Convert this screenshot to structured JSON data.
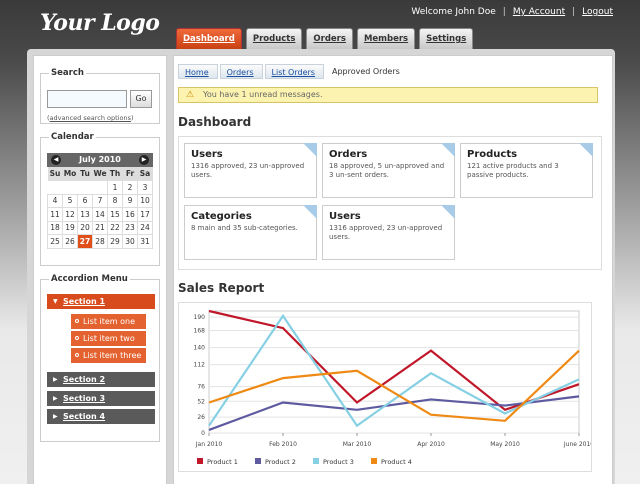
{
  "header": {
    "logo": "Your Logo",
    "welcome": "Welcome John Doe",
    "my_account": "My Account",
    "logout": "Logout",
    "separator": "|"
  },
  "tabs": [
    {
      "label": "Dashboard",
      "active": true
    },
    {
      "label": "Products"
    },
    {
      "label": "Orders"
    },
    {
      "label": "Members"
    },
    {
      "label": "Settings"
    }
  ],
  "sidebar": {
    "search": {
      "legend": "Search",
      "value": "",
      "button": "Go",
      "advanced": "advanced search options"
    },
    "calendar": {
      "legend": "Calendar",
      "month": "July 2010",
      "prev": "◀",
      "next": "▶",
      "weekdays": [
        "Su",
        "Mo",
        "Tu",
        "We",
        "Th",
        "Fr",
        "Sa"
      ],
      "weeks": [
        [
          "",
          "",
          "",
          "",
          "1",
          "2",
          "3"
        ],
        [
          "4",
          "5",
          "6",
          "7",
          "8",
          "9",
          "10"
        ],
        [
          "11",
          "12",
          "13",
          "14",
          "15",
          "16",
          "17"
        ],
        [
          "18",
          "19",
          "20",
          "21",
          "22",
          "23",
          "24"
        ],
        [
          "25",
          "26",
          "27",
          "28",
          "29",
          "30",
          "31"
        ]
      ],
      "today": "27"
    },
    "accordion": {
      "legend": "Accordion Menu",
      "sections": [
        {
          "label": "Section 1",
          "open": true,
          "items": [
            "List item one",
            "List item two",
            "List item three"
          ]
        },
        {
          "label": "Section 2"
        },
        {
          "label": "Section 3"
        },
        {
          "label": "Section 4"
        }
      ]
    }
  },
  "main": {
    "breadcrumb": [
      "Home",
      "Orders",
      "List Orders",
      "Approved Orders"
    ],
    "alert": "You have 1 unread messages.",
    "dashboard_title": "Dashboard",
    "cards": [
      {
        "title": "Users",
        "desc": "1316 approved, 23 un-approved users."
      },
      {
        "title": "Orders",
        "desc": "18 approved, 5 un-approved and 3 un-sent orders."
      },
      {
        "title": "Products",
        "desc": "121 active products and 3 passive products."
      },
      {
        "title": "Categories",
        "desc": "8 main and 35 sub-categories."
      },
      {
        "title": "Users",
        "desc": "1316 approved, 23 un-approved users."
      }
    ],
    "sales_title": "Sales Report"
  },
  "chart_data": {
    "type": "line",
    "title": "Sales Report",
    "x": [
      "Jan 2010",
      "Feb 2010",
      "Mar 2010",
      "Apr 2010",
      "May 2010",
      "June 2010"
    ],
    "yticks": [
      0,
      26,
      52,
      76,
      112,
      140,
      168,
      190
    ],
    "ylim": [
      0,
      200
    ],
    "grid": true,
    "legend_position": "bottom",
    "series": [
      {
        "name": "Product 1",
        "color": "#c0182a",
        "values": [
          200,
          172,
          50,
          135,
          38,
          80
        ]
      },
      {
        "name": "Product 2",
        "color": "#5e5aa0",
        "values": [
          5,
          50,
          38,
          55,
          45,
          60
        ]
      },
      {
        "name": "Product 3",
        "color": "#86d0e4",
        "values": [
          12,
          192,
          12,
          98,
          32,
          88
        ]
      },
      {
        "name": "Product 4",
        "color": "#ee8a14",
        "values": [
          50,
          90,
          102,
          30,
          20,
          135
        ]
      }
    ]
  }
}
